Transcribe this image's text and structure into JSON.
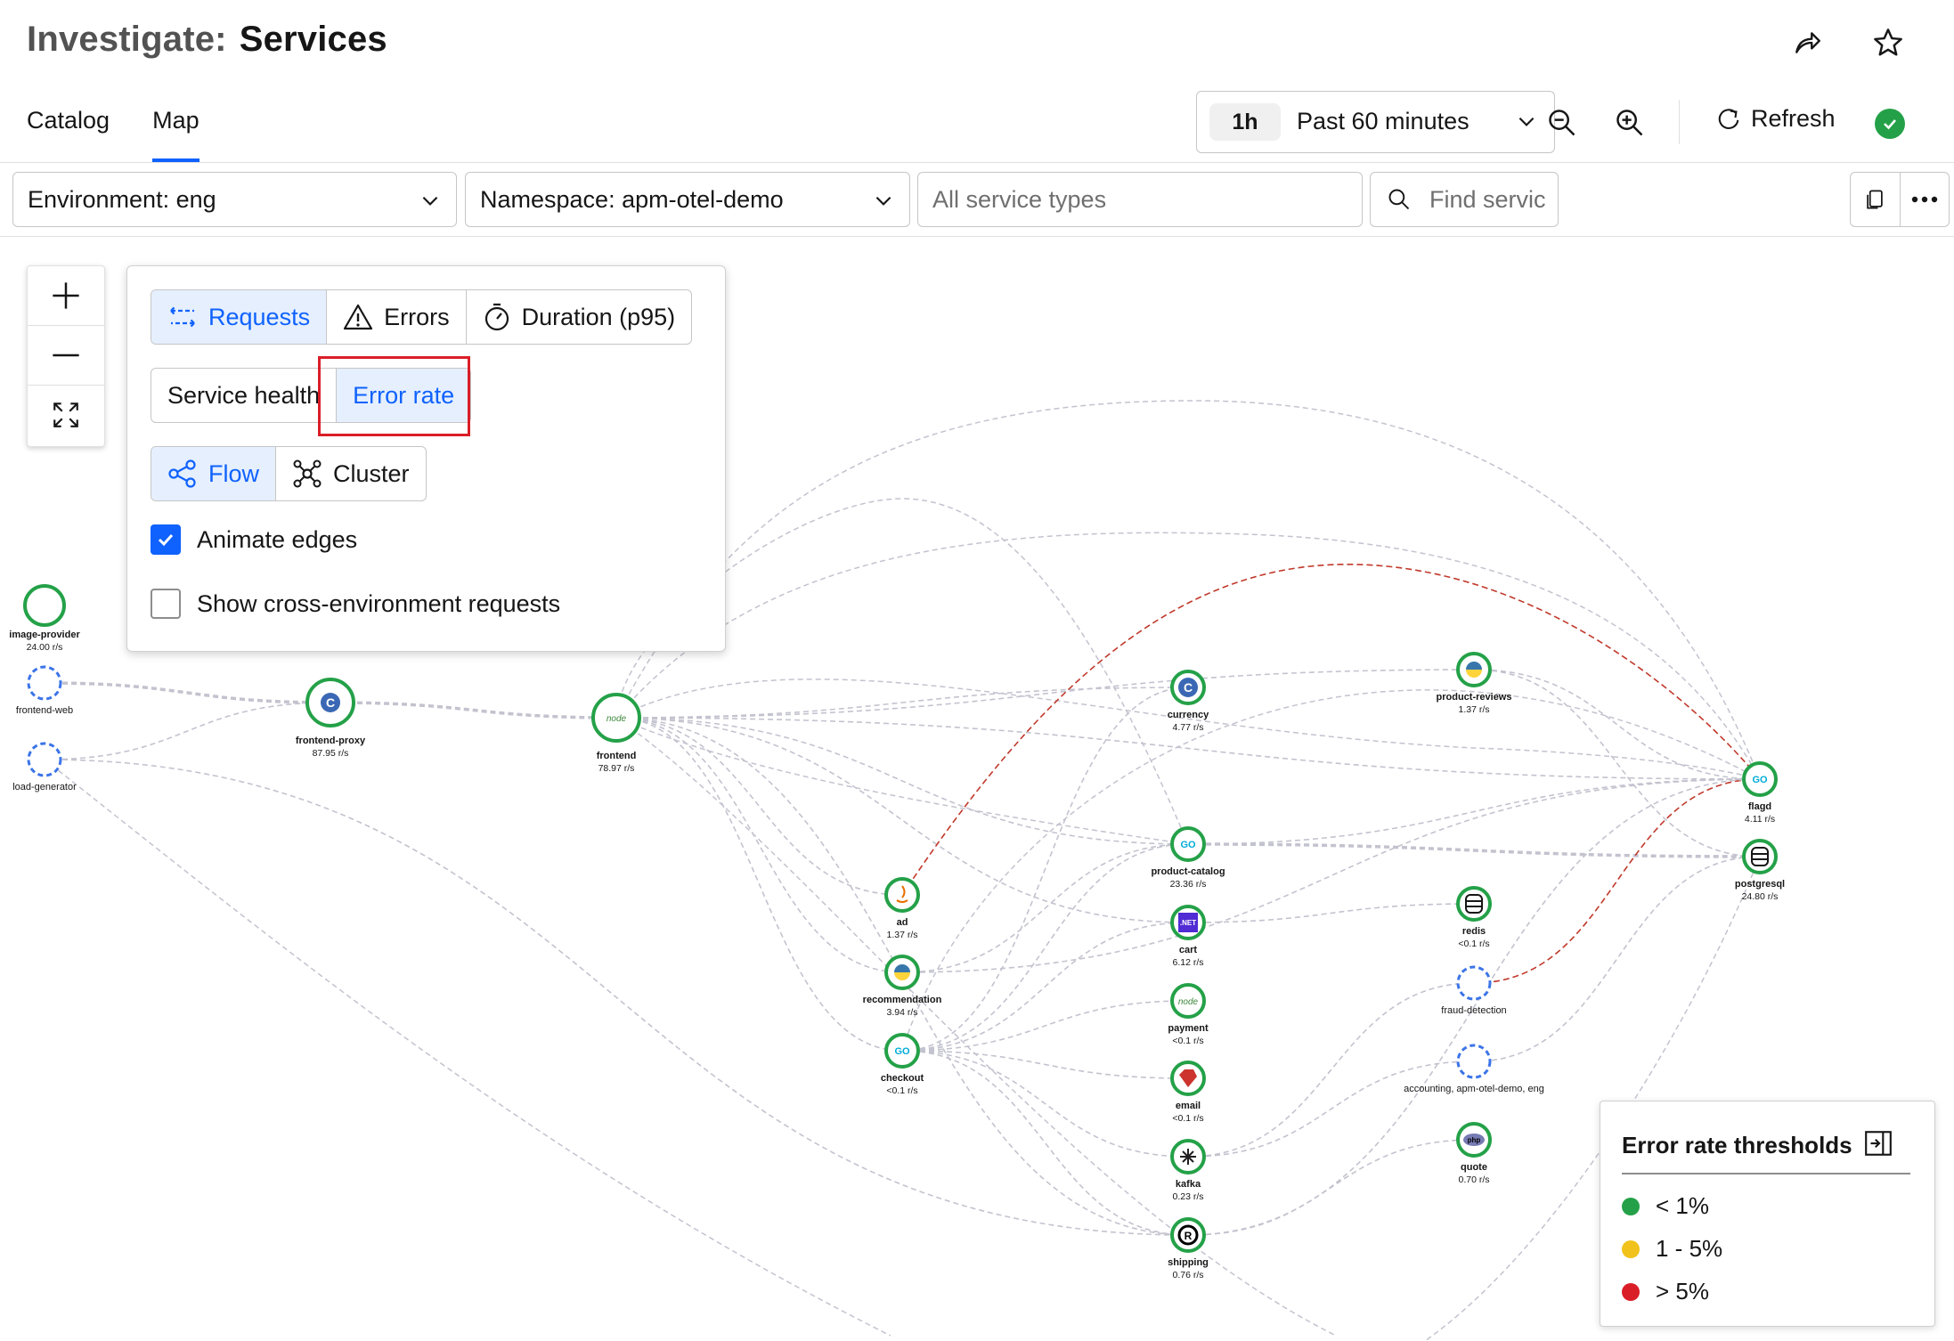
{
  "header": {
    "title_prefix": "Investigate:",
    "title": "Services",
    "share_icon": "share-icon",
    "star_icon": "star-icon"
  },
  "tabs": [
    {
      "label": "Catalog",
      "active": false
    },
    {
      "label": "Map",
      "active": true
    }
  ],
  "toolbar": {
    "time_chip": "1h",
    "time_label": "Past 60 minutes",
    "refresh_label": "Refresh",
    "status": "ok"
  },
  "filters": {
    "environment": "Environment: eng",
    "namespace": "Namespace: apm-otel-demo",
    "service_types_placeholder": "All service types",
    "find_placeholder": "Find servic"
  },
  "panel": {
    "metric_options": [
      {
        "label": "Requests",
        "icon": "requests-icon",
        "selected": true
      },
      {
        "label": "Errors",
        "icon": "warning-icon",
        "selected": false
      },
      {
        "label": "Duration (p95)",
        "icon": "timer-icon",
        "selected": false
      }
    ],
    "color_options": [
      {
        "label": "Service health",
        "selected": false
      },
      {
        "label": "Error rate",
        "selected": true
      }
    ],
    "layout_options": [
      {
        "label": "Flow",
        "icon": "flow-icon",
        "selected": true
      },
      {
        "label": "Cluster",
        "icon": "cluster-icon",
        "selected": false
      }
    ],
    "animate_edges": {
      "label": "Animate edges",
      "checked": true
    },
    "cross_env": {
      "label": "Show cross-environment requests",
      "checked": false
    }
  },
  "legend": {
    "title": "Error rate thresholds",
    "items": [
      {
        "label": "< 1%",
        "color": "#24a148"
      },
      {
        "label": "1 - 5%",
        "color": "#f1c21b"
      },
      {
        "label": "> 5%",
        "color": "#da1e28"
      }
    ]
  },
  "colors": {
    "accent": "#0f62fe",
    "healthy": "#24a148",
    "error": "#da1e28",
    "edge": "#c3c3cf"
  },
  "services": [
    {
      "id": "image-provider",
      "label": "image-provider",
      "rate": "24.00 r/s",
      "kind": "empty",
      "icon": "none"
    },
    {
      "id": "frontend-web",
      "label": "frontend-web",
      "rate": "",
      "kind": "dashed",
      "icon": "none"
    },
    {
      "id": "load-generator",
      "label": "load-generator",
      "rate": "",
      "kind": "dashed",
      "icon": "none"
    },
    {
      "id": "frontend-proxy",
      "label": "frontend-proxy",
      "rate": "87.95 r/s",
      "kind": "solid",
      "icon": "cpp-icon"
    },
    {
      "id": "frontend",
      "label": "frontend",
      "rate": "78.97 r/s",
      "kind": "solid",
      "icon": "node-icon"
    },
    {
      "id": "ad",
      "label": "ad",
      "rate": "1.37 r/s",
      "kind": "solid",
      "icon": "java-icon"
    },
    {
      "id": "recommendation",
      "label": "recommendation",
      "rate": "3.94 r/s",
      "kind": "solid",
      "icon": "python-icon"
    },
    {
      "id": "checkout",
      "label": "checkout",
      "rate": "<0.1 r/s",
      "kind": "solid",
      "icon": "go-icon"
    },
    {
      "id": "currency",
      "label": "currency",
      "rate": "4.77 r/s",
      "kind": "solid",
      "icon": "cpp-icon"
    },
    {
      "id": "product-catalog",
      "label": "product-catalog",
      "rate": "23.36 r/s",
      "kind": "solid",
      "icon": "go-icon"
    },
    {
      "id": "cart",
      "label": "cart",
      "rate": "6.12 r/s",
      "kind": "solid",
      "icon": "dotnet-icon"
    },
    {
      "id": "payment",
      "label": "payment",
      "rate": "<0.1 r/s",
      "kind": "solid",
      "icon": "node-icon"
    },
    {
      "id": "email",
      "label": "email",
      "rate": "<0.1 r/s",
      "kind": "solid",
      "icon": "ruby-icon"
    },
    {
      "id": "kafka",
      "label": "kafka",
      "rate": "0.23 r/s",
      "kind": "solid",
      "icon": "kafka-icon"
    },
    {
      "id": "shipping",
      "label": "shipping",
      "rate": "0.76 r/s",
      "kind": "solid",
      "icon": "rust-icon"
    },
    {
      "id": "product-reviews",
      "label": "product-reviews",
      "rate": "1.37 r/s",
      "kind": "solid",
      "icon": "python-icon"
    },
    {
      "id": "redis",
      "label": "redis",
      "rate": "<0.1 r/s",
      "kind": "solid",
      "icon": "database-icon"
    },
    {
      "id": "fraud-detection",
      "label": "fraud-detection",
      "rate": "",
      "kind": "dashed",
      "icon": "none"
    },
    {
      "id": "accounting",
      "label": "accounting, apm-otel-demo, eng",
      "rate": "",
      "kind": "dashed",
      "icon": "none"
    },
    {
      "id": "quote",
      "label": "quote",
      "rate": "0.70 r/s",
      "kind": "solid",
      "icon": "php-icon"
    },
    {
      "id": "flagd",
      "label": "flagd",
      "rate": "4.11 r/s",
      "kind": "solid",
      "icon": "go-icon"
    },
    {
      "id": "postgresql",
      "label": "postgresql",
      "rate": "24.80 r/s",
      "kind": "solid",
      "icon": "database-icon"
    }
  ],
  "edges": [
    {
      "from": "frontend-web",
      "to": "frontend-proxy",
      "error": false,
      "heavy": true
    },
    {
      "from": "frontend-proxy",
      "to": "frontend",
      "error": false,
      "heavy": true
    },
    {
      "from": "load-generator",
      "to": "frontend-proxy",
      "error": false,
      "heavy": false
    },
    {
      "from": "load-generator",
      "to": "shipping",
      "error": false,
      "heavy": false
    },
    {
      "from": "frontend",
      "to": "currency",
      "error": false,
      "heavy": false
    },
    {
      "from": "frontend",
      "to": "product-catalog",
      "error": false,
      "heavy": false
    },
    {
      "from": "frontend",
      "to": "cart",
      "error": false,
      "heavy": false
    },
    {
      "from": "frontend",
      "to": "ad",
      "error": false,
      "heavy": false
    },
    {
      "from": "frontend",
      "to": "recommendation",
      "error": false,
      "heavy": false
    },
    {
      "from": "frontend",
      "to": "checkout",
      "error": false,
      "heavy": false
    },
    {
      "from": "frontend",
      "to": "shipping",
      "error": false,
      "heavy": false
    },
    {
      "from": "frontend",
      "to": "product-reviews",
      "error": false,
      "heavy": false
    },
    {
      "from": "frontend",
      "to": "flagd",
      "error": false,
      "heavy": false
    },
    {
      "from": "ad",
      "to": "flagd",
      "error": true,
      "heavy": false
    },
    {
      "from": "recommendation",
      "to": "product-catalog",
      "error": false,
      "heavy": false
    },
    {
      "from": "recommendation",
      "to": "flagd",
      "error": false,
      "heavy": false
    },
    {
      "from": "checkout",
      "to": "cart",
      "error": false,
      "heavy": false
    },
    {
      "from": "checkout",
      "to": "payment",
      "error": false,
      "heavy": false
    },
    {
      "from": "checkout",
      "to": "email",
      "error": false,
      "heavy": false
    },
    {
      "from": "checkout",
      "to": "kafka",
      "error": false,
      "heavy": false
    },
    {
      "from": "checkout",
      "to": "shipping",
      "error": false,
      "heavy": false
    },
    {
      "from": "checkout",
      "to": "product-catalog",
      "error": false,
      "heavy": false
    },
    {
      "from": "checkout",
      "to": "currency",
      "error": false,
      "heavy": false
    },
    {
      "from": "product-catalog",
      "to": "postgresql",
      "error": false,
      "heavy": true
    },
    {
      "from": "product-catalog",
      "to": "flagd",
      "error": false,
      "heavy": false
    },
    {
      "from": "cart",
      "to": "redis",
      "error": false,
      "heavy": false
    },
    {
      "from": "product-reviews",
      "to": "postgresql",
      "error": false,
      "heavy": false
    },
    {
      "from": "product-reviews",
      "to": "flagd",
      "error": false,
      "heavy": false
    },
    {
      "from": "fraud-detection",
      "to": "flagd",
      "error": true,
      "heavy": false
    },
    {
      "from": "kafka",
      "to": "fraud-detection",
      "error": false,
      "heavy": false
    },
    {
      "from": "kafka",
      "to": "accounting",
      "error": false,
      "heavy": false
    },
    {
      "from": "accounting",
      "to": "postgresql",
      "error": false,
      "heavy": false
    },
    {
      "from": "shipping",
      "to": "quote",
      "error": false,
      "heavy": false
    },
    {
      "from": "shipping",
      "to": "flagd",
      "error": false,
      "heavy": false
    }
  ]
}
